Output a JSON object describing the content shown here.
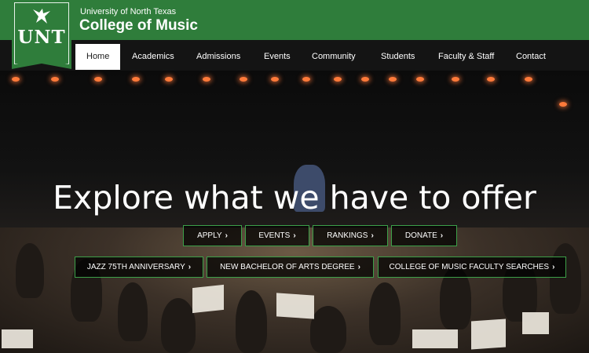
{
  "header": {
    "logo_text": "UNT",
    "university": "University of North Texas",
    "college": "College of Music"
  },
  "nav": {
    "items": [
      "Home",
      "Academics",
      "Admissions",
      "Events",
      "Community",
      "Students",
      "Faculty & Staff",
      "Contact"
    ],
    "active": "Home"
  },
  "hero": {
    "headline": "Explore what we have to offer",
    "buttons_row1": [
      "APPLY",
      "EVENTS",
      "RANKINGS",
      "DONATE"
    ],
    "buttons_row2": [
      "JAZZ 75TH ANNIVERSARY",
      "NEW BACHELOR OF ARTS DEGREE",
      "COLLEGE OF MUSIC FACULTY SEARCHES"
    ],
    "chevron": "chevron-right-icon"
  },
  "colors": {
    "brand_green": "#2f7d3b",
    "button_border": "#3ca048",
    "nav_background": "#141414"
  }
}
